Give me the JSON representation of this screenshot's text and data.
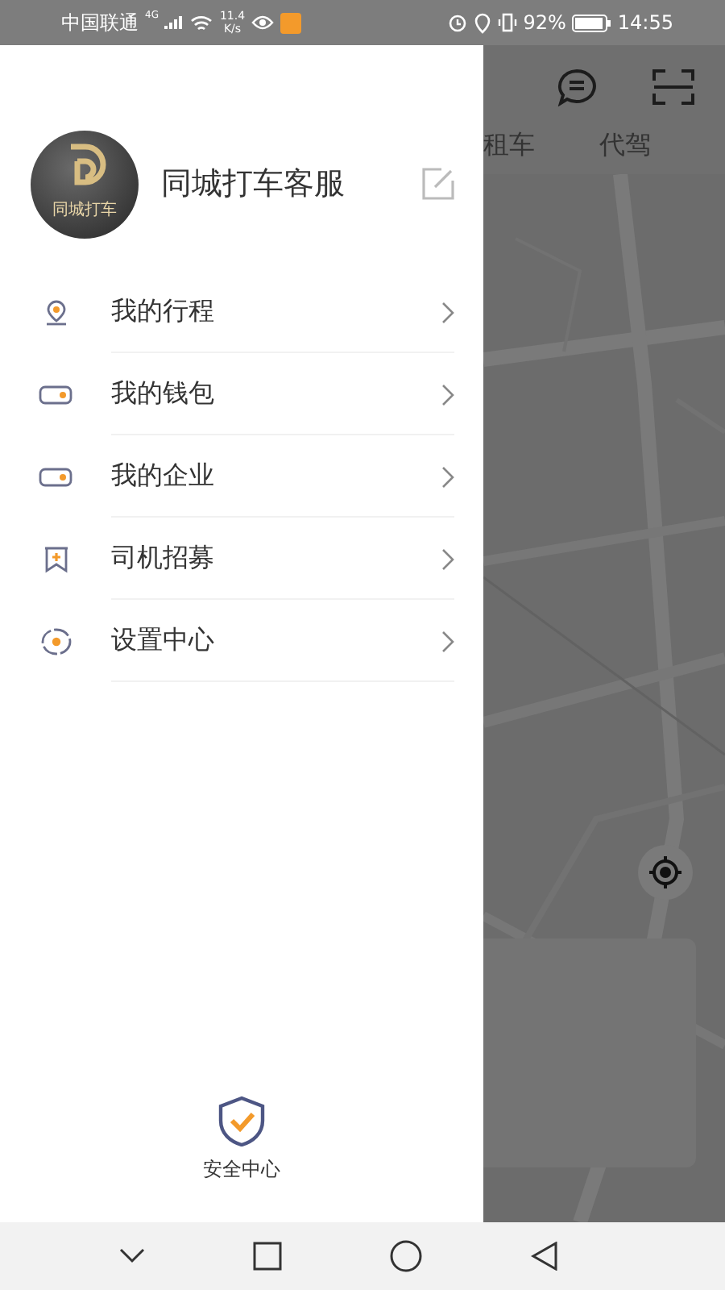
{
  "status_bar": {
    "carrier": "中国联通",
    "network": "4G",
    "speed_value": "11.4",
    "speed_unit": "K/s",
    "battery": "92%",
    "time": "14:55"
  },
  "drawer": {
    "avatar_text": "同城打车",
    "user_name": "同城打车客服",
    "menu": [
      {
        "label": "我的行程",
        "kind": "pin"
      },
      {
        "label": "我的钱包",
        "kind": "wallet"
      },
      {
        "label": "我的企业",
        "kind": "wallet"
      },
      {
        "label": "司机招募",
        "kind": "flag"
      },
      {
        "label": "设置中心",
        "kind": "gear"
      }
    ],
    "safety": {
      "label": "安全中心"
    }
  },
  "top_tabs": [
    {
      "label": "租车"
    },
    {
      "label": "代驾"
    }
  ]
}
